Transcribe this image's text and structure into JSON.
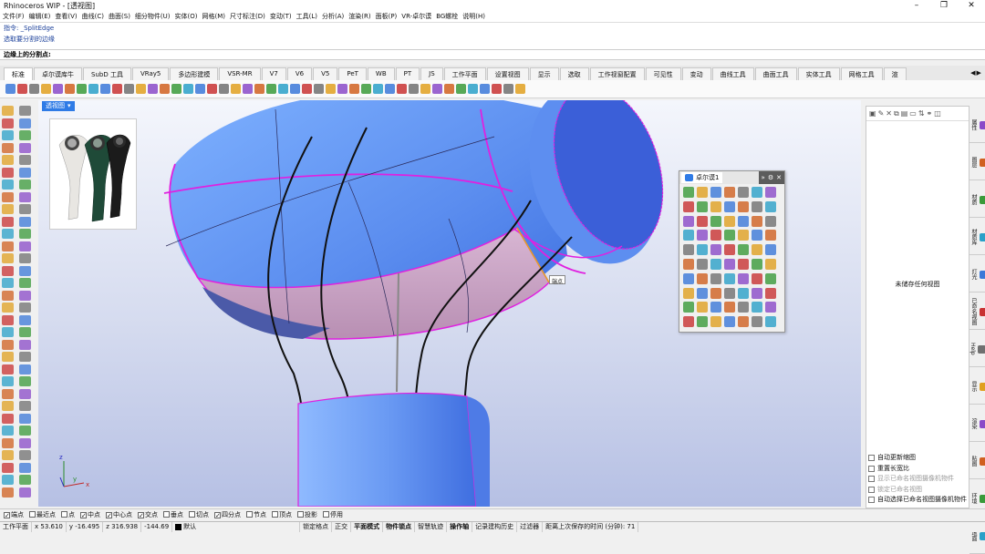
{
  "window": {
    "title": "Rhinoceros WIP - [透视图]"
  },
  "menu": [
    "文件(F)",
    "编辑(E)",
    "查看(V)",
    "曲线(C)",
    "曲面(S)",
    "细分物件(U)",
    "实体(O)",
    "网格(M)",
    "尺寸标注(D)",
    "变动(T)",
    "工具(L)",
    "分析(A)",
    "渲染(R)",
    "面板(P)",
    "VR-卓尔谟",
    "BG螺栓",
    "说明(H)"
  ],
  "command": {
    "history1": "指令: _SplitEdge",
    "history2": "选取要分割的边缘",
    "prompt": "边缘上的分割点:"
  },
  "tabs": [
    "标准",
    "卓尔谟库牛",
    "SubD 工具",
    "VRay5",
    "多边形建模",
    "VSR-MR",
    "V7",
    "V6",
    "V5",
    "PeT",
    "WB",
    "PT",
    "JS",
    "工作平面",
    "设置视图",
    "显示",
    "选取",
    "工作视窗配置",
    "可见性",
    "变动",
    "曲线工具",
    "曲面工具",
    "实体工具",
    "网格工具",
    "渲"
  ],
  "viewport": {
    "title": "透视图",
    "tooltip": "端点"
  },
  "float_panel": {
    "tab": "卓尔谟1"
  },
  "right_panel": {
    "empty_text": "未储存任何视图",
    "options": [
      {
        "label": "自动更新缩图",
        "disabled": false
      },
      {
        "label": "重置长宽比",
        "disabled": false
      },
      {
        "label": "显示已命名视图摄像机物件",
        "disabled": true
      },
      {
        "label": "锁定已命名视图",
        "disabled": true
      },
      {
        "label": "自动选择已命名视图摄像机物件",
        "disabled": false
      }
    ],
    "side_tabs": [
      "属性",
      "图层",
      "材质",
      "材质库",
      "灯光",
      "已命名视图",
      "Help",
      "显示",
      "渲染",
      "贴图",
      "环境",
      "地面"
    ]
  },
  "osnap": [
    {
      "label": "端点",
      "on": true
    },
    {
      "label": "最近点",
      "on": false
    },
    {
      "label": "点",
      "on": false
    },
    {
      "label": "中点",
      "on": true
    },
    {
      "label": "中心点",
      "on": true
    },
    {
      "label": "交点",
      "on": true
    },
    {
      "label": "垂点",
      "on": false
    },
    {
      "label": "切点",
      "on": false
    },
    {
      "label": "四分点",
      "on": true
    },
    {
      "label": "节点",
      "on": false
    },
    {
      "label": "顶点",
      "on": false
    },
    {
      "label": "投影",
      "on": false
    },
    {
      "label": "停用",
      "on": false
    }
  ],
  "status": {
    "cplane": "工作平面",
    "x": "x 53.610",
    "y": "y -16.495",
    "z": "z 316.938",
    "dist": "-144.69",
    "layer": "默认",
    "toggles": [
      "锁定格点",
      "正交",
      "平面模式",
      "物件锁点",
      "智慧轨迹",
      "操作轴",
      "记录建构历史",
      "过滤器"
    ],
    "bold_toggles": [
      "平面模式",
      "物件锁点",
      "操作轴"
    ],
    "saved": "距离上次保存的时间 (分钟): 71"
  },
  "colors": {
    "accent": "#2f7be6",
    "edge": "#e020e0",
    "surface": "#5b8def",
    "lower": "#c9a4c4"
  }
}
